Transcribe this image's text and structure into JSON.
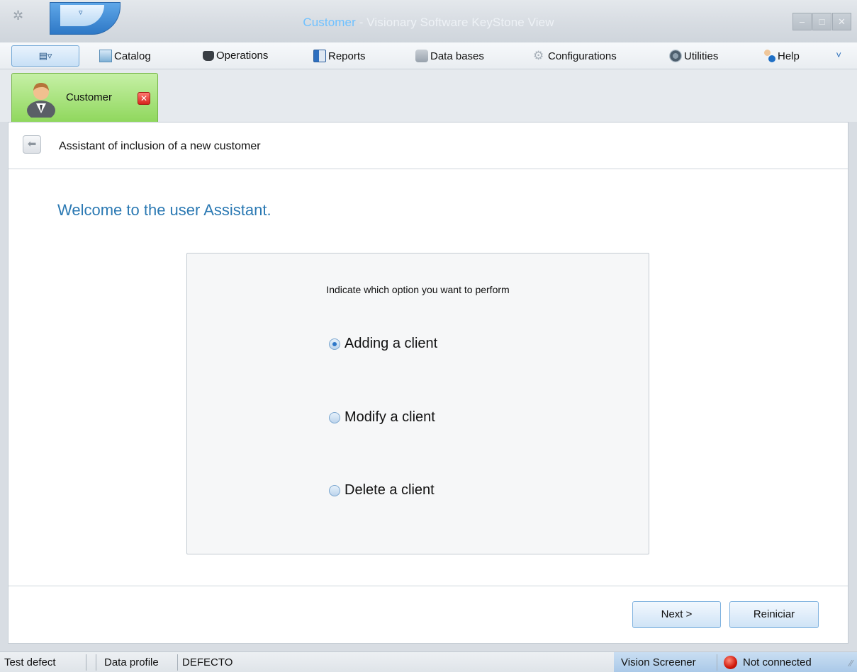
{
  "titlebar": {
    "title_highlight": "Customer",
    "title_rest": " - Visionary Software KeyStone View",
    "quick_menu_glyph": "▿",
    "minimize_glyph": "–",
    "maximize_glyph": "□",
    "close_glyph": "✕"
  },
  "menubar": {
    "toggle_label": "▤▿",
    "items": [
      {
        "label": "Catalog",
        "icon": "catalog-icon"
      },
      {
        "label": "Operations",
        "icon": "operations-icon"
      },
      {
        "label": "Reports",
        "icon": "reports-icon"
      },
      {
        "label": "Data bases",
        "icon": "database-icon"
      },
      {
        "label": "Configurations",
        "icon": "gear-icon"
      },
      {
        "label": "Utilities",
        "icon": "utilities-icon"
      },
      {
        "label": "Help",
        "icon": "help-icon"
      }
    ],
    "more_glyph": "˅"
  },
  "tab": {
    "label": "Customer",
    "close_glyph": "✕",
    "icon": "user-avatar-icon"
  },
  "assistant": {
    "back_glyph": "⬅",
    "header_title": "Assistant of inclusion of a new customer",
    "welcome": "Welcome to the user Assistant.",
    "prompt": "Indicate which option you want to perform",
    "options": [
      {
        "label": "Adding a client",
        "checked": true
      },
      {
        "label": "Modify a client",
        "checked": false
      },
      {
        "label": "Delete a client",
        "checked": false
      }
    ],
    "next_label": "Next >",
    "reset_label": "Reiniciar"
  },
  "statusbar": {
    "test_defect": "Test defect",
    "data_profile_label": "Data profile",
    "data_profile_value": "DEFECTO",
    "vision_screener": "Vision Screener",
    "connection": "Not connected",
    "connection_color": "#d0180a",
    "grip_glyph": "⁄⁄"
  }
}
